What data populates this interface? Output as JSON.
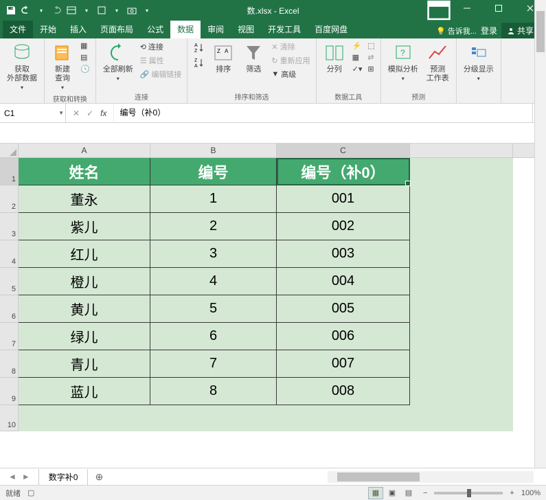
{
  "title": "数.xlsx - Excel",
  "tabs": {
    "file": "文件",
    "home": "开始",
    "insert": "插入",
    "pagelayout": "页面布局",
    "formulas": "公式",
    "data": "数据",
    "review": "审阅",
    "view": "视图",
    "developer": "开发工具",
    "baidu": "百度网盘"
  },
  "tellme": "告诉我...",
  "signin": "登录",
  "share": "共享",
  "ribbon": {
    "external": {
      "label": "获取\n外部数据",
      "caret": "▾"
    },
    "newquery": "新建\n查询",
    "group1": "获取和转换",
    "refresh": "全部刷新",
    "conn": "连接",
    "props": "属性",
    "editlinks": "编辑链接",
    "group2": "连接",
    "sort": "排序",
    "filter": "筛选",
    "clear": "清除",
    "reapply": "重新应用",
    "advanced": "高级",
    "group3": "排序和筛选",
    "texttocol": "分列",
    "group4": "数据工具",
    "whatif": "模拟分析",
    "forecast": "预测\n工作表",
    "group5": "预测",
    "outline": "分级显示",
    "group6": ""
  },
  "namebox": "C1",
  "formula": "编号（补0）",
  "columns": [
    "A",
    "B",
    "C"
  ],
  "headers": {
    "A": "姓名",
    "B": "编号",
    "C": "编号（补0）"
  },
  "rows": [
    {
      "A": "董永",
      "B": "1",
      "C": "001"
    },
    {
      "A": "紫儿",
      "B": "2",
      "C": "002"
    },
    {
      "A": "红儿",
      "B": "3",
      "C": "003"
    },
    {
      "A": "橙儿",
      "B": "4",
      "C": "004"
    },
    {
      "A": "黄儿",
      "B": "5",
      "C": "005"
    },
    {
      "A": "绿儿",
      "B": "6",
      "C": "006"
    },
    {
      "A": "青儿",
      "B": "7",
      "C": "007"
    },
    {
      "A": "蓝儿",
      "B": "8",
      "C": "008"
    }
  ],
  "sheet_tab": "数字补0",
  "status_ready": "就绪",
  "zoom": "100%"
}
